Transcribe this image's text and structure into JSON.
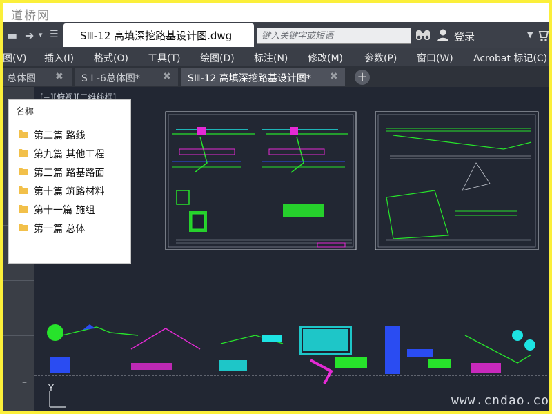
{
  "watermark": {
    "top": "道桥网",
    "bottom": "www.cndao.com"
  },
  "titlebar": {
    "document_title": "SⅢ-12 高填深挖路基设计图.dwg",
    "search_placeholder": "键入关键字或短语",
    "login_label": "登录",
    "icons": [
      "arrow-redo-icon",
      "dropdown-icon",
      "binoculars-icon",
      "user-icon",
      "cart-icon"
    ]
  },
  "menu": {
    "items": [
      "图(V)",
      "插入(I)",
      "格式(O)",
      "工具(T)",
      "绘图(D)",
      "标注(N)",
      "修改(M)",
      "参数(P)",
      "窗口(W)",
      "Acrobat 标记(C)"
    ]
  },
  "file_tabs": [
    {
      "label": "总体图",
      "active": false
    },
    {
      "label": "S I -6总体图*",
      "active": false
    },
    {
      "label": "SⅢ-12 高填深挖路基设计图*",
      "active": true
    }
  ],
  "canvas": {
    "view_label": "[−][俯视][二维线框]",
    "ucs_label": "Y"
  },
  "folder_panel": {
    "header": "名称",
    "items": [
      "第二篇 路线",
      "第九篇 其他工程",
      "第三篇 路基路面",
      "第十篇 筑路材料",
      "第十一篇 施组",
      "第一篇 总体"
    ]
  },
  "colors": {
    "canvas_bg": "#222733",
    "frame_border": "#fbef3a",
    "cad_green": "#27e32b",
    "cad_cyan": "#1de3e3",
    "cad_magenta": "#e52ad5",
    "cad_blue": "#2a4cf2"
  }
}
